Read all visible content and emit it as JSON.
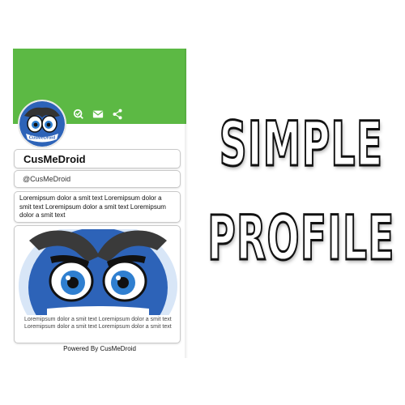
{
  "profile": {
    "name": "CusMeDroid",
    "handle": "@CusMeDroid",
    "bio": "Loremipsum dolor a smit text Loremipsum dolor a smit text Loremipsum dolor a smit text Loremipsum dolor a smit text",
    "image_caption": "Loremipsum dolor a smit text Loremipsum dolor a smit text Loremipsum dolor a smit text Loremipsum dolor a smit text",
    "avatar_badge": "CusMeDroid"
  },
  "header": {
    "color": "#5cb944",
    "icons": [
      "qr-scan-icon",
      "mail-icon",
      "share-icon"
    ]
  },
  "footer": {
    "text": "Powered By CusMeDroid"
  },
  "title": {
    "line1": "SIMPLE",
    "line2": "PROFILE"
  },
  "colors": {
    "mascot_blue": "#2d63b8",
    "eye_blue": "#2f7fd0"
  }
}
